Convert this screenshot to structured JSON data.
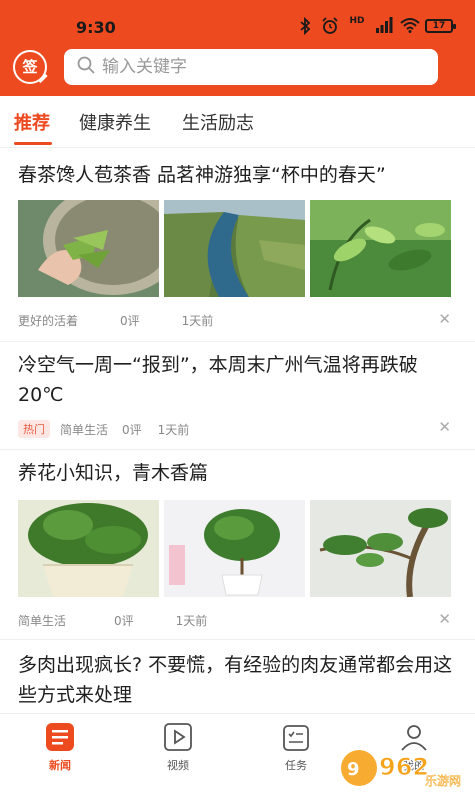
{
  "status_bar": {
    "time": "9:30",
    "battery": "17",
    "network": "HD"
  },
  "header": {
    "logo_char": "签"
  },
  "search": {
    "placeholder": "输入关键字"
  },
  "tabs": [
    {
      "label": "推荐",
      "active": true
    },
    {
      "label": "健康养生",
      "active": false
    },
    {
      "label": "生活励志",
      "active": false
    }
  ],
  "articles": [
    {
      "title": "春茶馋人苞茶香 品茗神游独享“杯中的春天”",
      "images": [
        "tea-leaves-in-hand",
        "river-valley-aerial",
        "tea-bush-closeup"
      ],
      "source": "更好的活着",
      "comments": "0评",
      "time": "1天前",
      "hot": ""
    },
    {
      "title": "冷空气一周一“报到”，本周末广州气温将再跌破20℃",
      "images": [],
      "source": "简单生活",
      "comments": "0评",
      "time": "1天前",
      "hot": "热门"
    },
    {
      "title": "养花小知识，青木香篇",
      "images": [
        "potted-plant-1",
        "potted-bonsai-2",
        "branch-closeup-3"
      ],
      "source": "简单生活",
      "comments": "0评",
      "time": "1天前",
      "hot": ""
    },
    {
      "title": "多肉出现疯长? 不要慌，有经验的肉友通常都会用这些方式来处理",
      "images": [],
      "source": "",
      "comments": "",
      "time": "",
      "hot": ""
    }
  ],
  "bottom_nav": [
    {
      "label": "新闻",
      "icon": "news-icon",
      "active": true
    },
    {
      "label": "视频",
      "icon": "video-icon",
      "active": false
    },
    {
      "label": "任务",
      "icon": "task-icon",
      "active": false
    },
    {
      "label": "我的",
      "icon": "profile-icon",
      "active": false
    }
  ],
  "watermark": {
    "text_big": "962",
    "text_small": ".cn",
    "sub": "乐游网"
  },
  "colors": {
    "brand": "#ee4a20",
    "text": "#1f1f1f",
    "meta": "#888888"
  }
}
